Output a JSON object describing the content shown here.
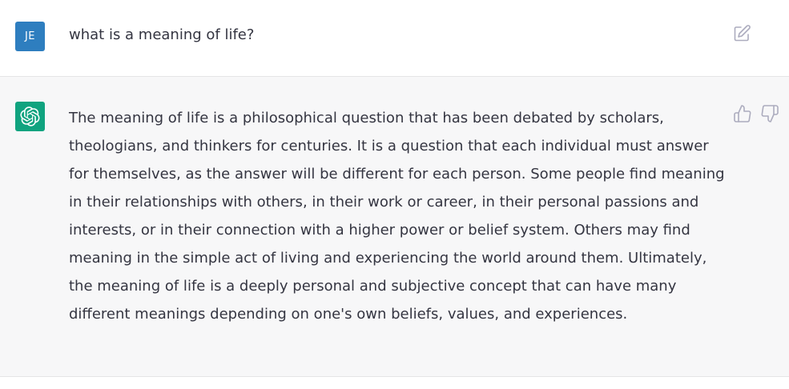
{
  "user_message": {
    "avatar_initials": "JE",
    "avatar_color": "#2e7ebf",
    "text": "what is a meaning of life?",
    "edit_icon": "edit-icon"
  },
  "assistant_message": {
    "avatar_icon": "openai-logo-icon",
    "avatar_color": "#10a37f",
    "text": "The meaning of life is a philosophical question that has been debated by scholars, theologians, and thinkers for centuries. It is a question that each individual must answer for themselves, as the answer will be different for each person. Some people find meaning in their relationships with others, in their work or career, in their personal passions and interests, or in their connection with a higher power or belief system. Others may find meaning in the simple act of living and experiencing the world around them. Ultimately, the meaning of life is a deeply personal and subjective concept that can have many different meanings depending on one's own beliefs, values, and experiences.",
    "feedback_icons": [
      "thumbs-up-icon",
      "thumbs-down-icon"
    ]
  }
}
